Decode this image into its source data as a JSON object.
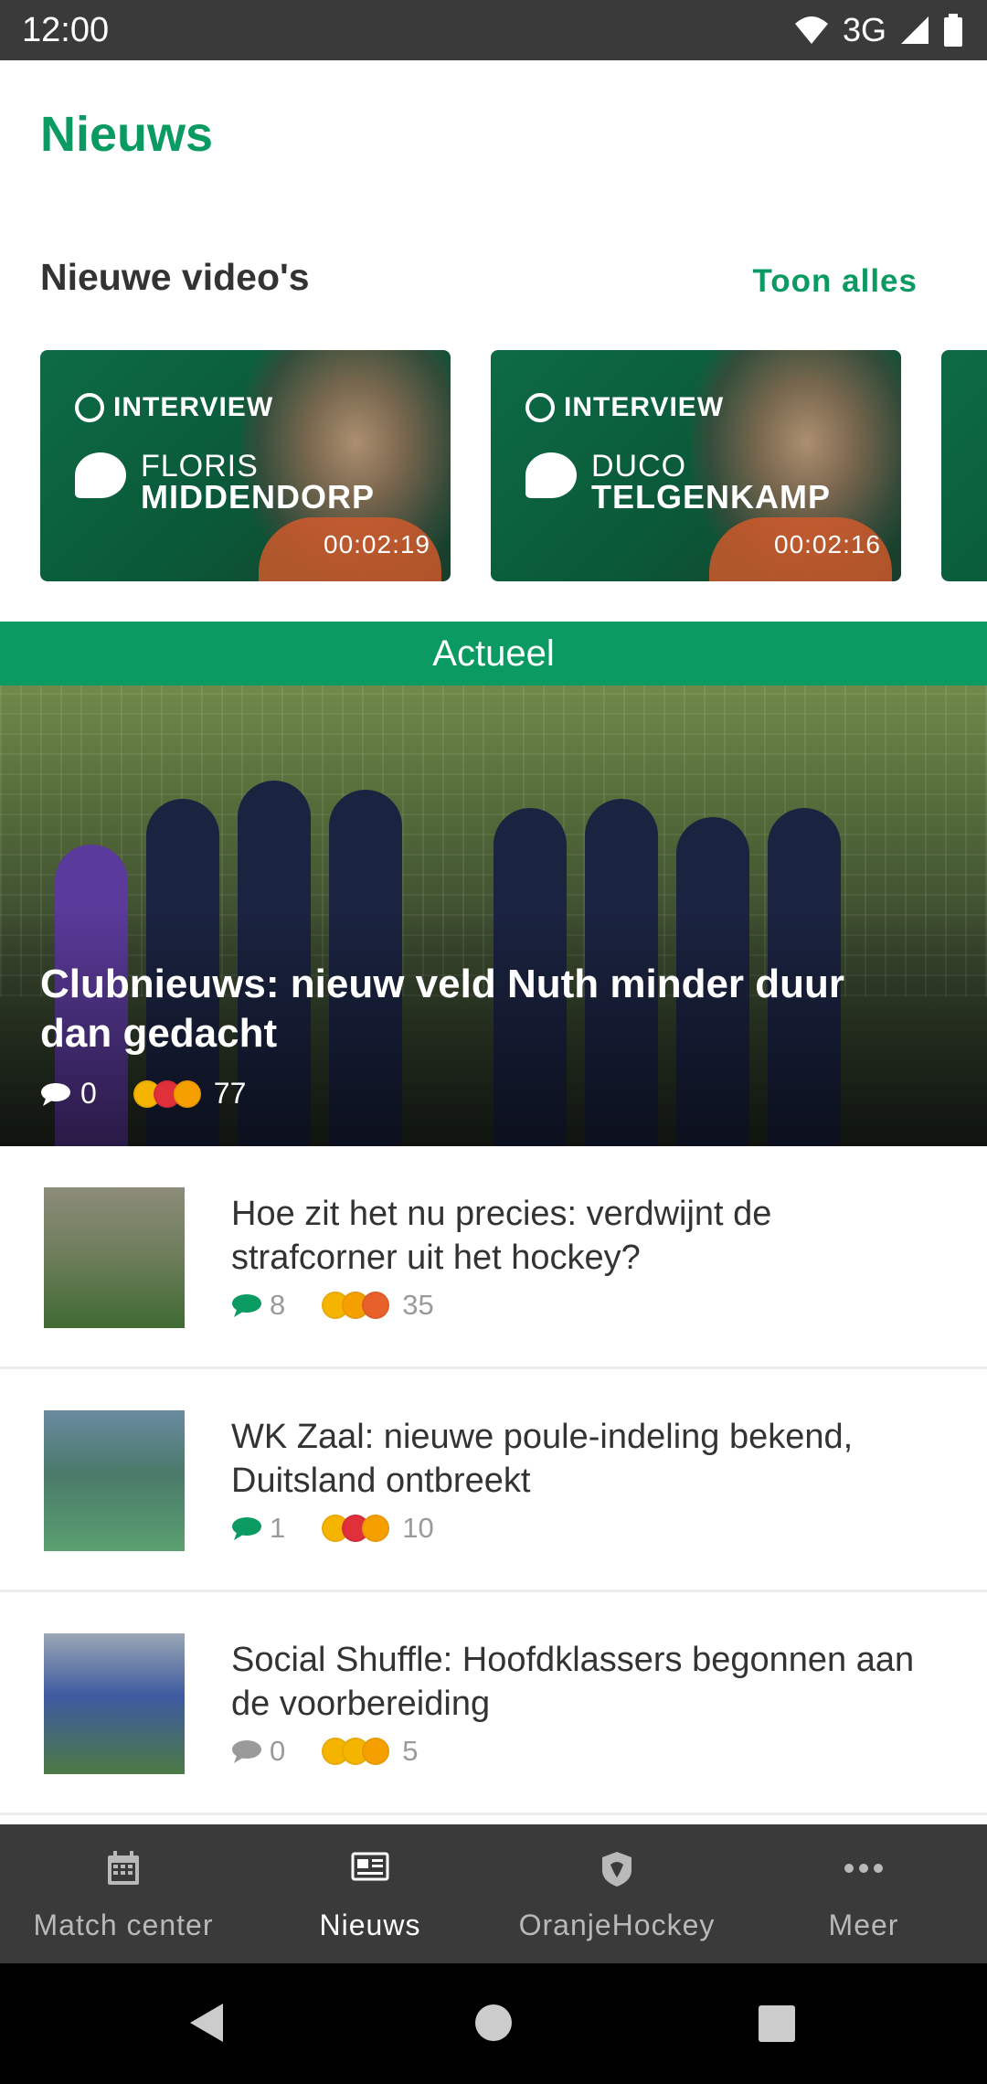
{
  "status_bar": {
    "time": "12:00",
    "network": "3G"
  },
  "page": {
    "title": "Nieuws"
  },
  "videos": {
    "section_title": "Nieuwe video's",
    "show_all": "Toon alles",
    "items": [
      {
        "tag": "INTERVIEW",
        "first_name": "FLORIS",
        "last_name": "MIDDENDORP",
        "duration": "00:02:19"
      },
      {
        "tag": "INTERVIEW",
        "first_name": "DUCO",
        "last_name": "TELGENKAMP",
        "duration": "00:02:16"
      }
    ]
  },
  "actueel": {
    "label": "Actueel"
  },
  "hero": {
    "title": "Clubnieuws: nieuw veld Nuth minder duur dan gedacht",
    "comments": "0",
    "reactions": "77"
  },
  "articles": [
    {
      "title": "Hoe zit het nu precies: verdwijnt de strafcorner uit het hockey?",
      "comments": "8",
      "reactions": "35",
      "comment_color": "#0b9b62"
    },
    {
      "title": "WK Zaal: nieuwe poule-indeling bekend, Duitsland ontbreekt",
      "comments": "1",
      "reactions": "10",
      "comment_color": "#0b9b62"
    },
    {
      "title": "Social Shuffle: Hoofdklassers begonnen aan de voorbereiding",
      "comments": "0",
      "reactions": "5",
      "comment_color": "#9a9a9a"
    }
  ],
  "bottom_nav": {
    "items": [
      {
        "label": "Match center",
        "icon": "calendar-icon"
      },
      {
        "label": "Nieuws",
        "icon": "newspaper-icon"
      },
      {
        "label": "OranjeHockey",
        "icon": "shield-icon"
      },
      {
        "label": "Meer",
        "icon": "more-dots-icon"
      }
    ],
    "active": "Nieuws"
  },
  "colors": {
    "brand_green": "#0b9b62",
    "nav_bg": "#3a3a3a"
  }
}
